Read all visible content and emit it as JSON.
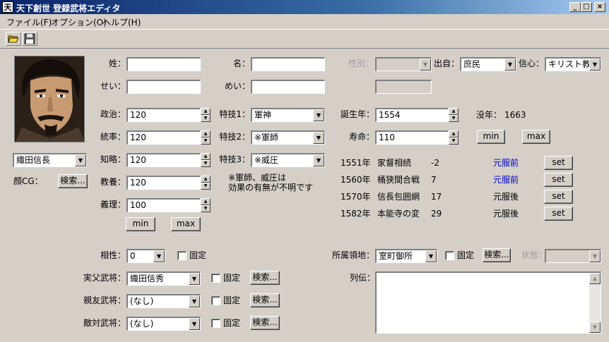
{
  "window": {
    "title": "天下創世 登録武将エディタ",
    "app_icon_glyph": "天"
  },
  "window_buttons": {
    "minimize": "_",
    "maximize": "□",
    "close": "×"
  },
  "menu": [
    "ファイル(F)",
    "オプション(O)",
    "ヘルプ(H)"
  ],
  "toolbar": {
    "open_icon": "folder-open-icon",
    "save_icon": "floppy-disk-icon"
  },
  "officer": {
    "select": "織田信長",
    "face_label": "顔CG：",
    "face_search": "検索..."
  },
  "name": {
    "sei_label": "姓：",
    "sei_value": "",
    "mei_label": "名：",
    "mei_value": "",
    "sei_kana_label": "せい：",
    "sei_kana_value": "",
    "mei_kana_label": "めい：",
    "mei_kana_value": ""
  },
  "stats": [
    {
      "label": "政治：",
      "value": "120"
    },
    {
      "label": "統率：",
      "value": "120"
    },
    {
      "label": "知略：",
      "value": "120"
    },
    {
      "label": "教養：",
      "value": "120"
    },
    {
      "label": "義理：",
      "value": "100"
    }
  ],
  "stat_buttons": {
    "min": "min",
    "max": "max"
  },
  "skills": [
    {
      "label": "特技1：",
      "value": "軍神"
    },
    {
      "label": "特技2：",
      "value": "※軍師"
    },
    {
      "label": "特技3：",
      "value": "※威圧"
    }
  ],
  "skill_note": [
    "※軍師、威圧は",
    "効果の有無が不明です"
  ],
  "profile": {
    "gender_label": "性別：",
    "gender_value": "",
    "origin_label": "出自：",
    "origin_value": "庶民",
    "faith_label": "信心：",
    "faith_value": "キリスト教",
    "birth_label": "誕生年：",
    "birth_value": "1554",
    "death_label": "没年：",
    "death_value": "1663",
    "life_label": "寿命：",
    "life_value": "110",
    "life_min": "min",
    "life_max": "max"
  },
  "events": [
    {
      "year": "1551年",
      "name": "家督相続",
      "value": "-2",
      "status": "元服前",
      "status_color": "#0000c8",
      "button": "set"
    },
    {
      "year": "1560年",
      "name": "桶狭間合戦",
      "value": "7",
      "status": "元服前",
      "status_color": "#0000c8",
      "button": "set"
    },
    {
      "year": "1570年",
      "name": "信長包囲網",
      "value": "17",
      "status": "元服後",
      "status_color": "#000000",
      "button": "set"
    },
    {
      "year": "1582年",
      "name": "本能寺の変",
      "value": "29",
      "status": "元服後",
      "status_color": "#000000",
      "button": "set"
    }
  ],
  "relations": {
    "affinity_label": "相性：",
    "affinity_value": "0",
    "fixed_label": "固定",
    "rows": [
      {
        "label": "実父武将：",
        "value": "織田信秀",
        "fixed": "固定",
        "search": "検索..."
      },
      {
        "label": "親友武将：",
        "value": "(なし)",
        "fixed": "固定",
        "search": "検索..."
      },
      {
        "label": "敵対武将：",
        "value": "(なし)",
        "fixed": "固定",
        "search": "検索..."
      }
    ]
  },
  "domain": {
    "label": "所属領地：",
    "value": "室町御所",
    "fixed": "固定",
    "search": "検索...",
    "state_label": "状態：",
    "state_value": ""
  },
  "biography": {
    "label": "列伝：",
    "value": ""
  }
}
